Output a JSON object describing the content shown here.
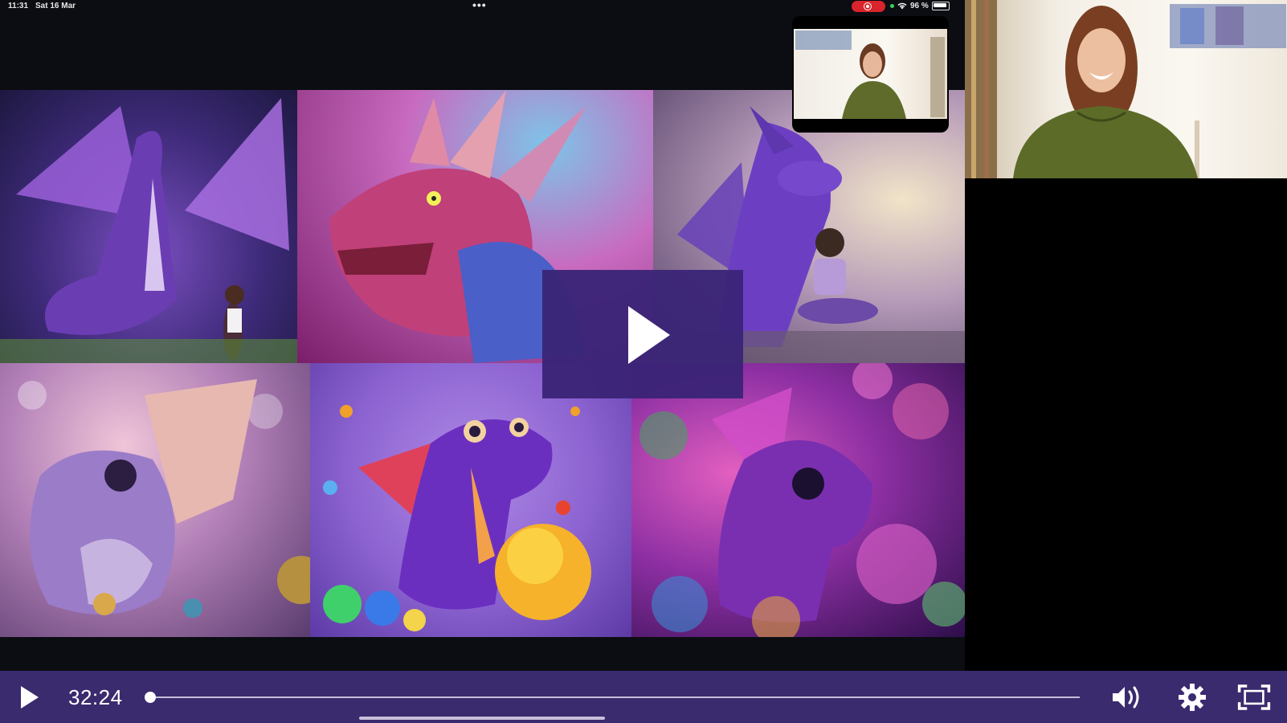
{
  "status_bar": {
    "time": "11:31",
    "date": "Sat 16 Mar",
    "battery": "96 %"
  },
  "gallery": {
    "tiles": [
      "purple winged dragon with child",
      "dragon head close-up",
      "purple dragon with seated child",
      "sparkly baby dragon",
      "cartoon baby dragon with ball",
      "jeweled dragon among bubbles"
    ]
  },
  "player": {
    "current_time": "32:24",
    "progress_fraction": 0.0
  },
  "icons": {
    "play": "play-icon",
    "volume": "volume-icon",
    "settings": "gear-icon",
    "fullscreen": "fullscreen-icon",
    "record": "record-icon",
    "wifi": "wifi-icon",
    "battery": "battery-icon"
  },
  "colors": {
    "control_bar": "#3a2a6e",
    "overlay": "#3a2476",
    "record": "#d8242c"
  }
}
